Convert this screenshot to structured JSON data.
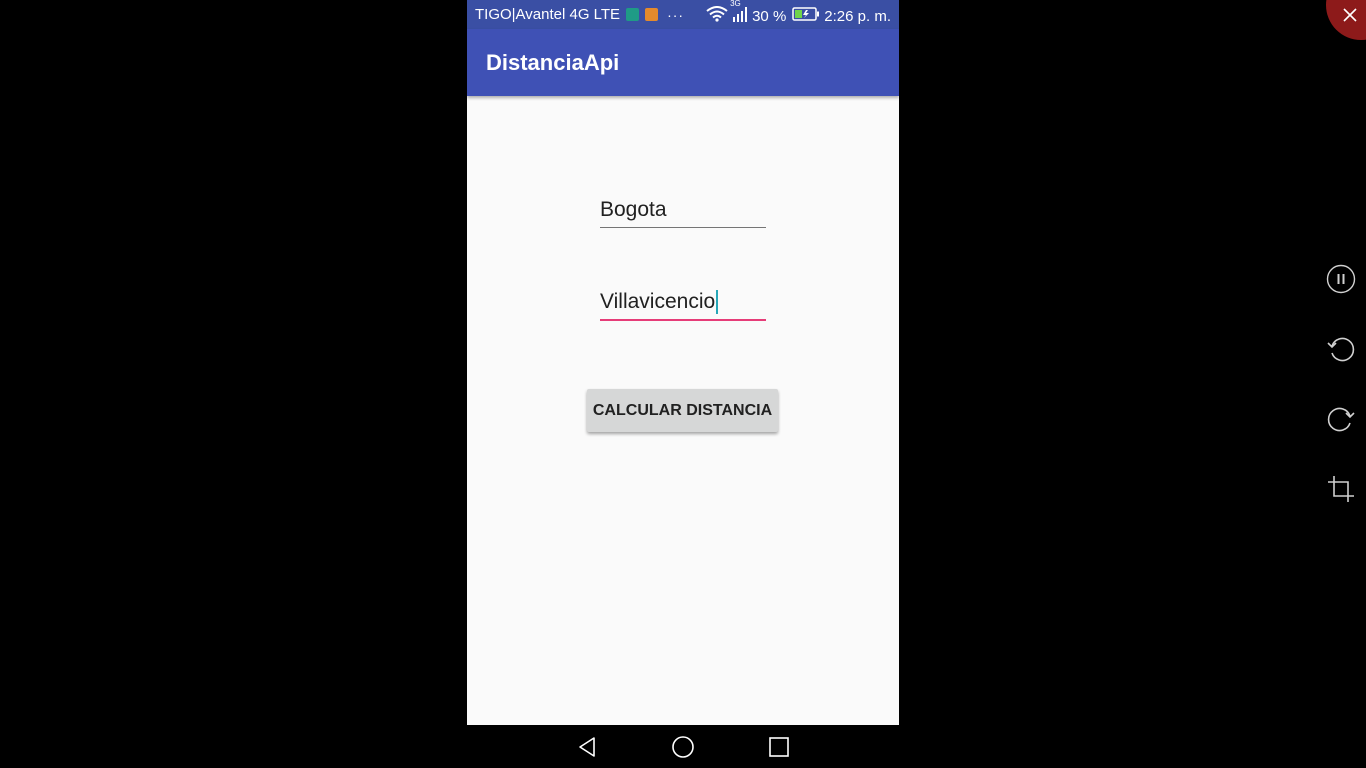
{
  "status_bar": {
    "carrier": "TIGO|Avantel 4G LTE",
    "overflow": "···",
    "network_type": "3G",
    "battery_percent": "30 %",
    "time": "2:26 p. m.",
    "icons": [
      "app-notification-icon",
      "app-notification-icon",
      "wifi-icon",
      "signal-icon",
      "battery-charging-icon"
    ]
  },
  "app_bar": {
    "title": "DistanciaApi"
  },
  "form": {
    "origin": {
      "value": "Bogota"
    },
    "destination": {
      "value": "Villavicencio",
      "focused": true
    },
    "calculate_button_label": "CALCULAR DISTANCIA"
  },
  "nav_bar": {
    "buttons": [
      "back-icon",
      "home-icon",
      "recents-icon"
    ]
  },
  "side_controls": {
    "buttons": [
      "close-icon",
      "pause-icon",
      "rotate-left-icon",
      "rotate-right-icon",
      "crop-icon"
    ]
  },
  "colors": {
    "status_bar": "#3a4fa4",
    "app_bar": "#3f51b5",
    "accent": "#e63c78",
    "background": "#fafafa",
    "button": "#d6d7d7"
  }
}
